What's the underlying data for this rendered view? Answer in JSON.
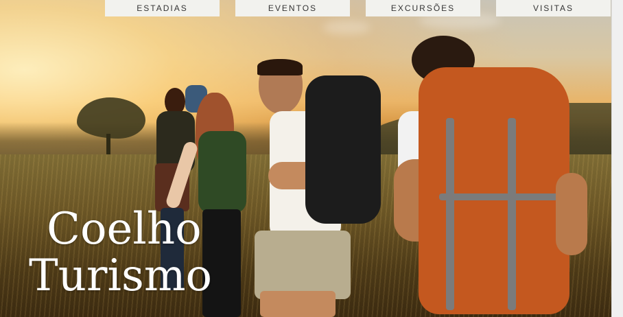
{
  "nav": {
    "items": [
      {
        "label": "ESTADIAS"
      },
      {
        "label": "EVENTOS"
      },
      {
        "label": "EXCURSÕES"
      },
      {
        "label": "VISITAS"
      }
    ]
  },
  "hero": {
    "brand_line1": "Coelho",
    "brand_line2": "Turismo",
    "image_description_icon": "hikers-photo"
  },
  "colors": {
    "nav_bg": "#f2f2ee",
    "nav_text": "#333333",
    "brand_text": "#ffffff"
  }
}
